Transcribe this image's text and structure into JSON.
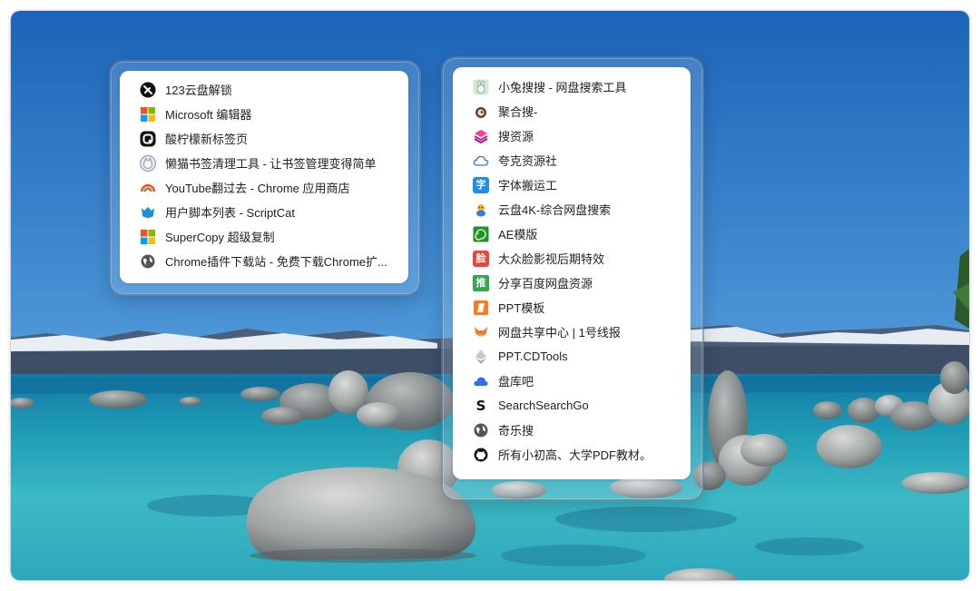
{
  "left_panel": {
    "items": [
      {
        "label": "123云盘解锁",
        "icon": "blade-circle-icon"
      },
      {
        "label": "Microsoft 编辑器",
        "icon": "microsoft-logo-icon"
      },
      {
        "label": "酸柠檬新标签页",
        "icon": "lemon-tab-icon"
      },
      {
        "label": "懒猫书签清理工具 - 让书签管理变得简单",
        "icon": "cat-avatar-icon"
      },
      {
        "label": "YouTube翻过去 - Chrome 应用商店",
        "icon": "rainbow-icon"
      },
      {
        "label": "用户脚本列表 - ScriptCat",
        "icon": "scriptcat-icon"
      },
      {
        "label": "SuperCopy 超级复制",
        "icon": "microsoft-logo-icon"
      },
      {
        "label": "Chrome插件下载站 - 免费下载Chrome扩...",
        "icon": "globe-icon"
      }
    ]
  },
  "right_panel": {
    "items": [
      {
        "label": "小兔搜搜 - 网盘搜索工具",
        "icon": "rabbit-icon"
      },
      {
        "label": "聚合搜-",
        "icon": "squirrel-icon"
      },
      {
        "label": "搜资源",
        "icon": "stack-icon"
      },
      {
        "label": "夸克资源社",
        "icon": "cloud-outline-icon"
      },
      {
        "label": "字体搬运工",
        "icon": "zi-char-icon",
        "glyph": "字"
      },
      {
        "label": "云盘4K-综合网盘搜索",
        "icon": "mascot-icon"
      },
      {
        "label": "AE模版",
        "icon": "green-spiral-icon"
      },
      {
        "label": "大众脸影视后期特效",
        "icon": "lian-char-icon",
        "glyph": "脸"
      },
      {
        "label": "分享百度网盘资源",
        "icon": "tui-char-icon",
        "glyph": "推"
      },
      {
        "label": "PPT模板",
        "icon": "ppt-icon"
      },
      {
        "label": "网盘共享中心 | 1号线报",
        "icon": "fox-icon"
      },
      {
        "label": "PPT.CDTools",
        "icon": "ethereum-icon"
      },
      {
        "label": "盘库吧",
        "icon": "blue-cloud-icon"
      },
      {
        "label": "SearchSearchGo",
        "icon": "s-letter-icon",
        "glyph": "S"
      },
      {
        "label": "奇乐搜",
        "icon": "globe-icon"
      },
      {
        "label": "所有小初高、大学PDF教材。",
        "icon": "github-icon"
      }
    ]
  },
  "colors": {
    "sky_top": "#1f6fc4",
    "sky_bottom": "#7fb8e6",
    "water_deep": "#1b8fb0",
    "water_shallow": "#4fc2cf",
    "panel_bg": "#ffffff",
    "text": "#1f1f1f"
  }
}
